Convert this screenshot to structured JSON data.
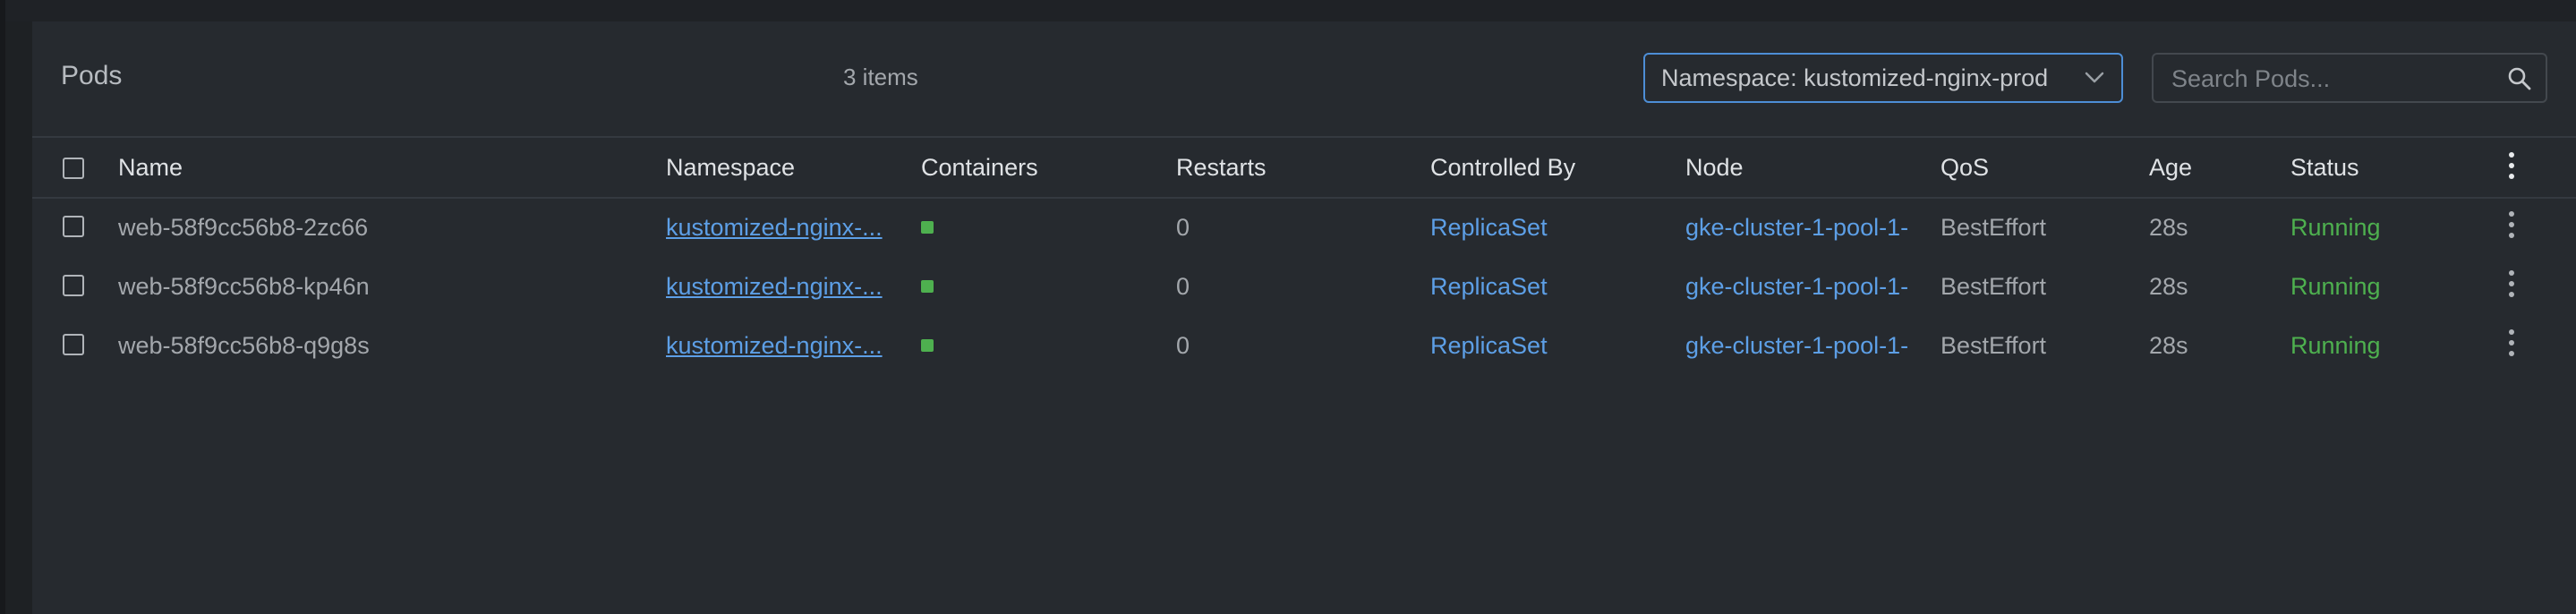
{
  "page": {
    "title": "Pods",
    "item_count": "3 items",
    "namespace_select": "Namespace: kustomized-nginx-prod",
    "search_placeholder": "Search Pods..."
  },
  "columns": [
    "Name",
    "Namespace",
    "Containers",
    "Restarts",
    "Controlled By",
    "Node",
    "QoS",
    "Age",
    "Status"
  ],
  "rows": [
    {
      "name": "web-58f9cc56b8-2zc66",
      "namespace": "kustomized-nginx-...",
      "restarts": "0",
      "controlled_by": "ReplicaSet",
      "node": "gke-cluster-1-pool-1-",
      "qos": "BestEffort",
      "age": "28s",
      "status": "Running"
    },
    {
      "name": "web-58f9cc56b8-kp46n",
      "namespace": "kustomized-nginx-...",
      "restarts": "0",
      "controlled_by": "ReplicaSet",
      "node": "gke-cluster-1-pool-1-",
      "qos": "BestEffort",
      "age": "28s",
      "status": "Running"
    },
    {
      "name": "web-58f9cc56b8-q9g8s",
      "namespace": "kustomized-nginx-...",
      "restarts": "0",
      "controlled_by": "ReplicaSet",
      "node": "gke-cluster-1-pool-1-",
      "qos": "BestEffort",
      "age": "28s",
      "status": "Running"
    }
  ],
  "colors": {
    "accent": "#4d8ed6",
    "link": "#5d9fe6",
    "running": "#4eb04f",
    "panel": "#262a2f"
  },
  "icons": {
    "namespace_dropdown": "chevron-down-icon",
    "search": "search-icon",
    "column_menu": "more-vertical-icon",
    "row_menu": "more-vertical-icon",
    "container_status": "container-status-square"
  }
}
